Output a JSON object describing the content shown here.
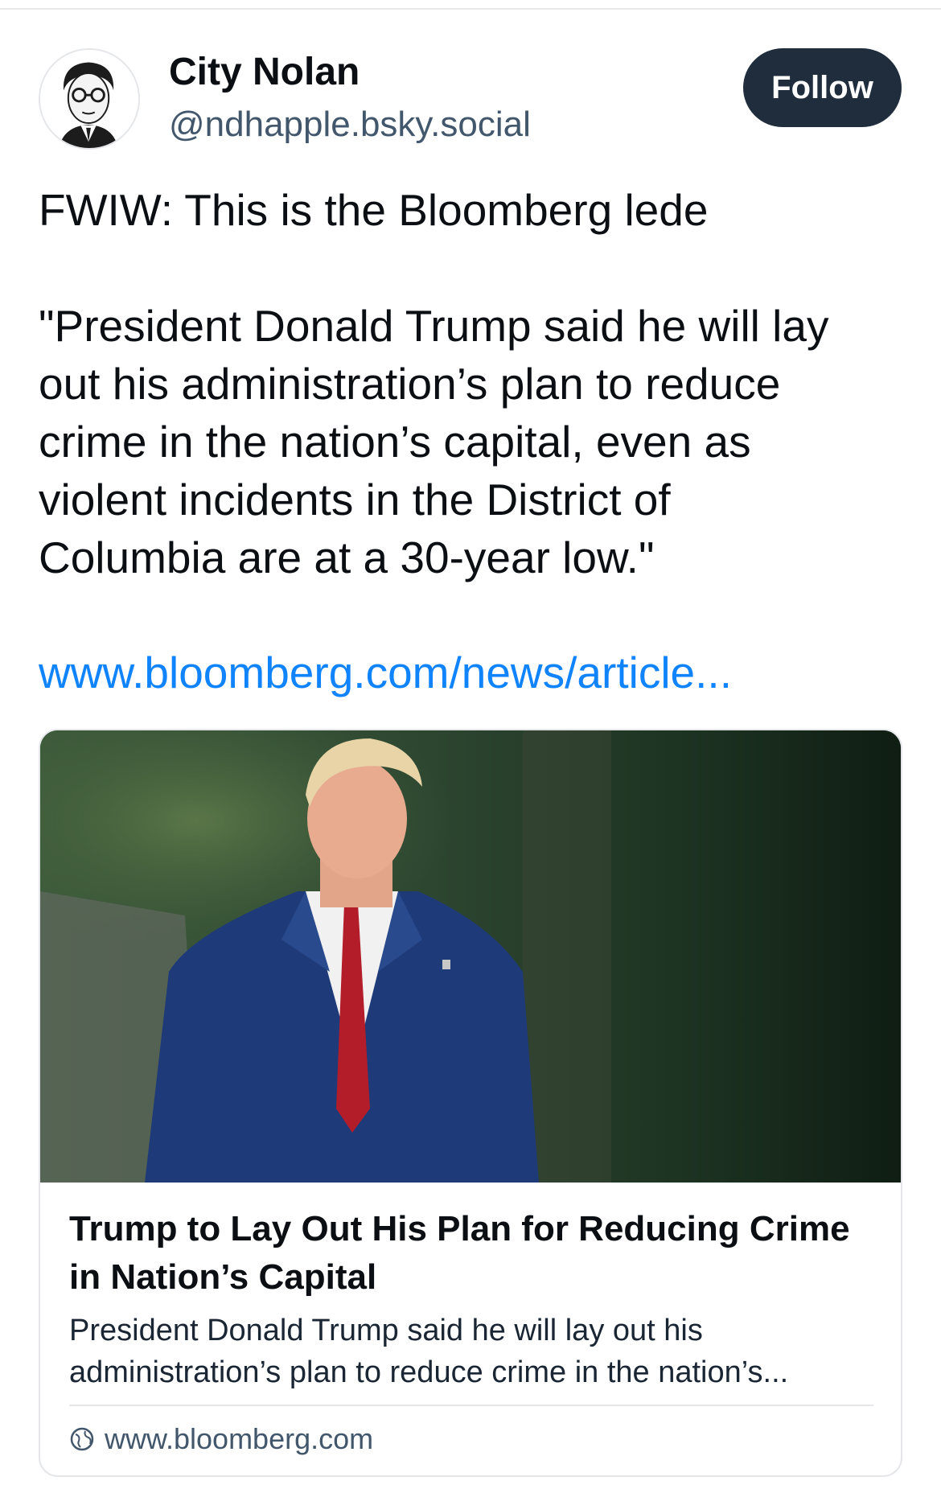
{
  "author": {
    "display_name": "City Nolan",
    "handle": "@ndhapple.bsky.social",
    "avatar_icon": "caricature-avatar"
  },
  "follow_label": "Follow",
  "post": {
    "lines_1": [
      "FWIW: This is the Bloomberg lede"
    ],
    "lines_2": [
      "\"President Donald Trump said he will lay",
      "out his administration’s plan to reduce",
      "crime in the nation’s capital, even as",
      "violent incidents in the District of",
      "Columbia are at a 30-year low.\""
    ],
    "link_text": "www.bloomberg.com/news/article..."
  },
  "embed": {
    "image_alt": "photo-of-trump-in-blue-suit",
    "title_lines": [
      "Trump to Lay Out His Plan for Reducing Crime",
      "in Nation’s Capital"
    ],
    "description_lines": [
      "President Donald Trump said he will lay out his",
      "administration’s plan to reduce crime in the nation’s..."
    ],
    "domain": "www.bloomberg.com",
    "domain_icon": "globe-icon"
  },
  "colors": {
    "link": "#1083fe",
    "follow_bg": "#1f2d3d",
    "handle": "#42576c"
  }
}
